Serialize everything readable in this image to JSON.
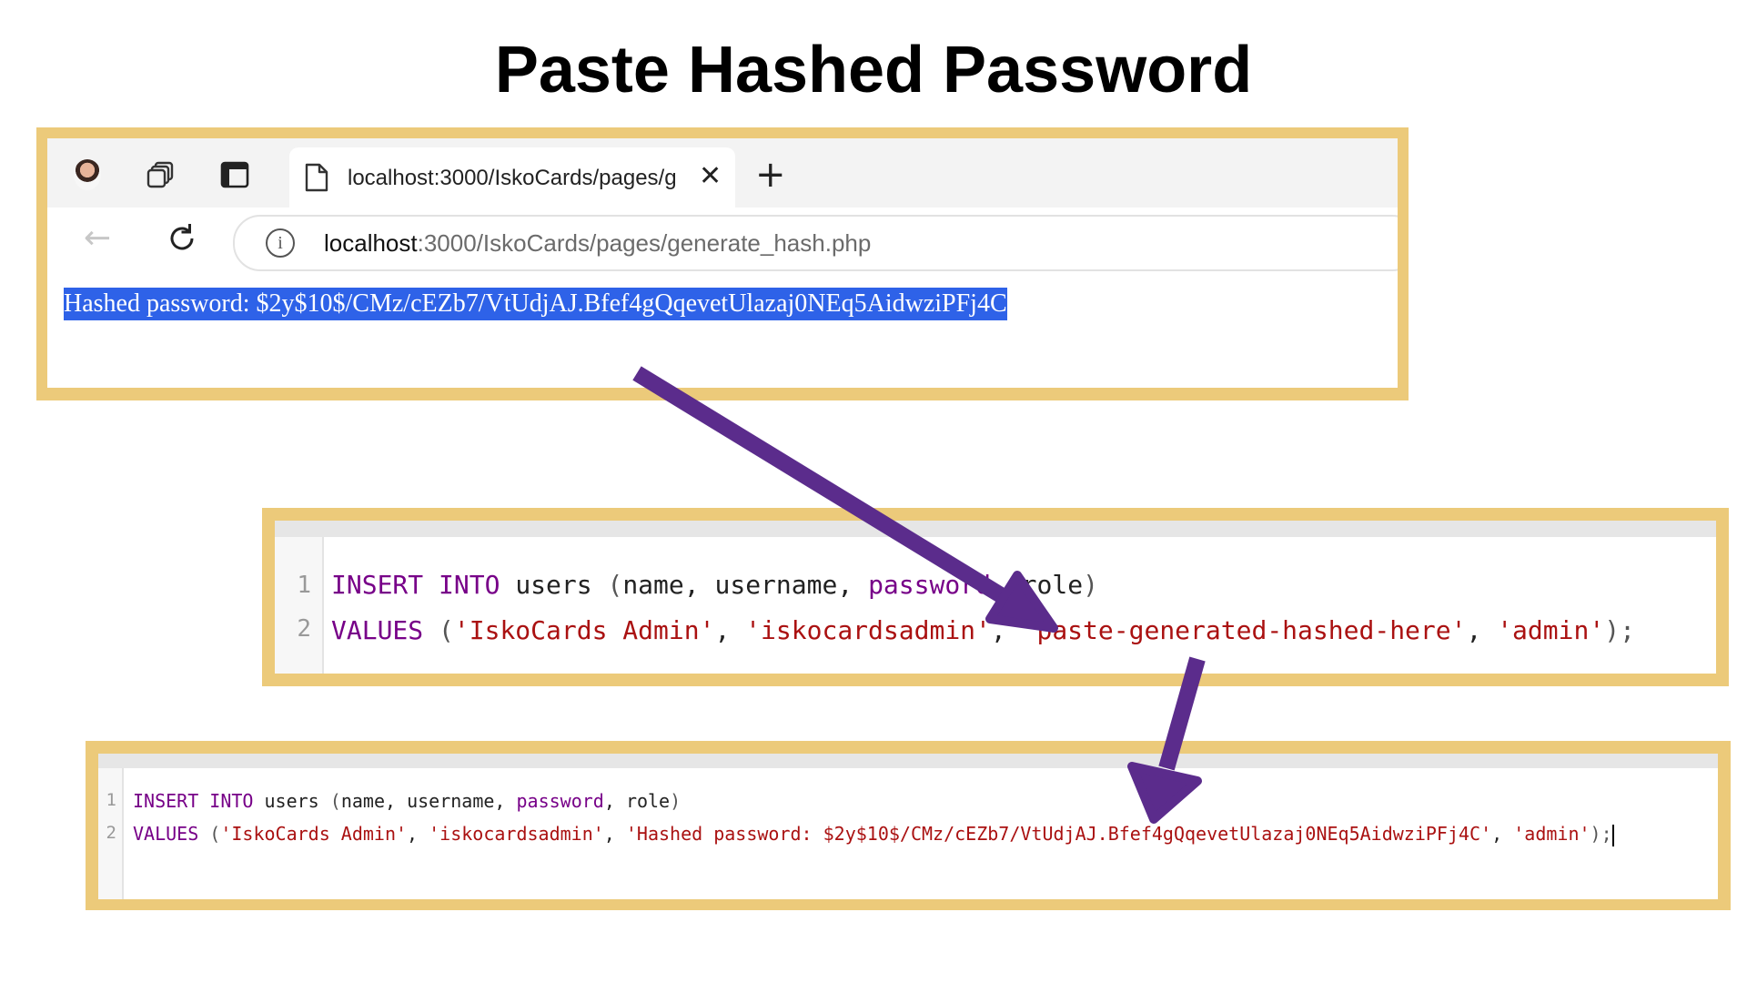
{
  "title": "Paste Hashed Password",
  "browser": {
    "profile_icon": "avatar-icon",
    "tab": {
      "label": "localhost:3000/IskoCards/pages/g",
      "close_glyph": "✕"
    },
    "new_tab_glyph": "+",
    "address": {
      "host": "localhost",
      "rest": ":3000/IskoCards/pages/generate_hash.php"
    },
    "page_text": "Hashed password: $2y$10$/CMz/cEZb7/VtUdjAJ.Bfef4gQqevetUlazaj0NEq5AidwziPFj4C"
  },
  "editor_before": {
    "line_numbers": [
      "1",
      "2"
    ],
    "line1": {
      "insert": "INSERT",
      "into": "INTO",
      "table": "users",
      "open": "(",
      "c1": "name",
      "sep1": ", ",
      "c2": "username",
      "sep2": ", ",
      "c3": "password",
      "sep3": ", ",
      "c4": "role",
      "close": ")"
    },
    "line2": {
      "values": "VALUES",
      "open": "(",
      "s1": "'IskoCards Admin'",
      "sep1": ", ",
      "s2": "'iskocardsadmin'",
      "sep2": ", ",
      "s3": "'paste-generated-hashed-here'",
      "sep3": ", ",
      "s4": "'admin'",
      "close": ");"
    }
  },
  "editor_after": {
    "line_numbers": [
      "1",
      "2"
    ],
    "line1": {
      "insert": "INSERT",
      "into": "INTO",
      "table": "users",
      "open": "(",
      "c1": "name",
      "sep1": ", ",
      "c2": "username",
      "sep2": ", ",
      "c3": "password",
      "sep3": ", ",
      "c4": "role",
      "close": ")"
    },
    "line2": {
      "values": "VALUES",
      "open": "(",
      "s1": "'IskoCards Admin'",
      "sep1": ", ",
      "s2": "'iskocardsadmin'",
      "sep2": ", ",
      "s3": "'Hashed password: $2y$10$/CMz/cEZb7/VtUdjAJ.Bfef4gQqevetUlazaj0NEq5AidwziPFj4C'",
      "sep3": ", ",
      "s4": "'admin'",
      "close": ");"
    }
  },
  "colors": {
    "frame": "#ecca7a",
    "arrow": "#5b2c8c",
    "selection": "#2e62e8",
    "sql_keyword": "#770088",
    "sql_string": "#aa1111"
  }
}
